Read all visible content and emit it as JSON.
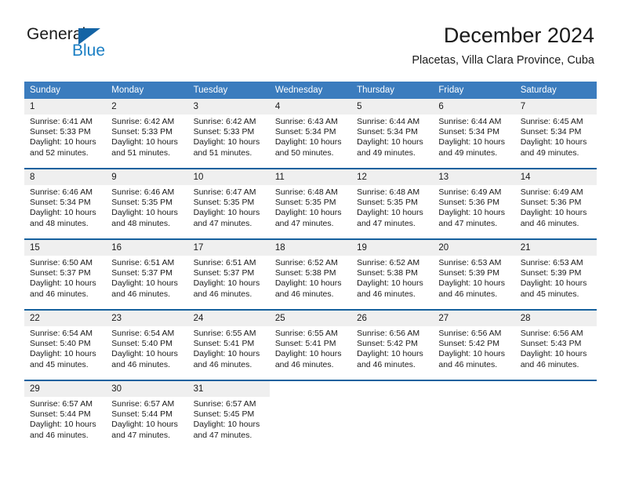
{
  "brand": {
    "name_top": "General",
    "name_bottom": "Blue",
    "triangle_color": "#1464a5",
    "blue_text_color": "#1b7fc4"
  },
  "header": {
    "title": "December 2024",
    "subtitle": "Placetas, Villa Clara Province, Cuba"
  },
  "colors": {
    "header_row_bg": "#3b7cbe",
    "row_separator": "#16619e",
    "daynum_band": "#efefef",
    "text": "#1a1a1a",
    "page_bg": "#ffffff"
  },
  "weekday_headers": [
    "Sunday",
    "Monday",
    "Tuesday",
    "Wednesday",
    "Thursday",
    "Friday",
    "Saturday"
  ],
  "weeks": [
    [
      {
        "day": "1",
        "sunrise": "Sunrise: 6:41 AM",
        "sunset": "Sunset: 5:33 PM",
        "daylight1": "Daylight: 10 hours",
        "daylight2": "and 52 minutes."
      },
      {
        "day": "2",
        "sunrise": "Sunrise: 6:42 AM",
        "sunset": "Sunset: 5:33 PM",
        "daylight1": "Daylight: 10 hours",
        "daylight2": "and 51 minutes."
      },
      {
        "day": "3",
        "sunrise": "Sunrise: 6:42 AM",
        "sunset": "Sunset: 5:33 PM",
        "daylight1": "Daylight: 10 hours",
        "daylight2": "and 51 minutes."
      },
      {
        "day": "4",
        "sunrise": "Sunrise: 6:43 AM",
        "sunset": "Sunset: 5:34 PM",
        "daylight1": "Daylight: 10 hours",
        "daylight2": "and 50 minutes."
      },
      {
        "day": "5",
        "sunrise": "Sunrise: 6:44 AM",
        "sunset": "Sunset: 5:34 PM",
        "daylight1": "Daylight: 10 hours",
        "daylight2": "and 49 minutes."
      },
      {
        "day": "6",
        "sunrise": "Sunrise: 6:44 AM",
        "sunset": "Sunset: 5:34 PM",
        "daylight1": "Daylight: 10 hours",
        "daylight2": "and 49 minutes."
      },
      {
        "day": "7",
        "sunrise": "Sunrise: 6:45 AM",
        "sunset": "Sunset: 5:34 PM",
        "daylight1": "Daylight: 10 hours",
        "daylight2": "and 49 minutes."
      }
    ],
    [
      {
        "day": "8",
        "sunrise": "Sunrise: 6:46 AM",
        "sunset": "Sunset: 5:34 PM",
        "daylight1": "Daylight: 10 hours",
        "daylight2": "and 48 minutes."
      },
      {
        "day": "9",
        "sunrise": "Sunrise: 6:46 AM",
        "sunset": "Sunset: 5:35 PM",
        "daylight1": "Daylight: 10 hours",
        "daylight2": "and 48 minutes."
      },
      {
        "day": "10",
        "sunrise": "Sunrise: 6:47 AM",
        "sunset": "Sunset: 5:35 PM",
        "daylight1": "Daylight: 10 hours",
        "daylight2": "and 47 minutes."
      },
      {
        "day": "11",
        "sunrise": "Sunrise: 6:48 AM",
        "sunset": "Sunset: 5:35 PM",
        "daylight1": "Daylight: 10 hours",
        "daylight2": "and 47 minutes."
      },
      {
        "day": "12",
        "sunrise": "Sunrise: 6:48 AM",
        "sunset": "Sunset: 5:35 PM",
        "daylight1": "Daylight: 10 hours",
        "daylight2": "and 47 minutes."
      },
      {
        "day": "13",
        "sunrise": "Sunrise: 6:49 AM",
        "sunset": "Sunset: 5:36 PM",
        "daylight1": "Daylight: 10 hours",
        "daylight2": "and 47 minutes."
      },
      {
        "day": "14",
        "sunrise": "Sunrise: 6:49 AM",
        "sunset": "Sunset: 5:36 PM",
        "daylight1": "Daylight: 10 hours",
        "daylight2": "and 46 minutes."
      }
    ],
    [
      {
        "day": "15",
        "sunrise": "Sunrise: 6:50 AM",
        "sunset": "Sunset: 5:37 PM",
        "daylight1": "Daylight: 10 hours",
        "daylight2": "and 46 minutes."
      },
      {
        "day": "16",
        "sunrise": "Sunrise: 6:51 AM",
        "sunset": "Sunset: 5:37 PM",
        "daylight1": "Daylight: 10 hours",
        "daylight2": "and 46 minutes."
      },
      {
        "day": "17",
        "sunrise": "Sunrise: 6:51 AM",
        "sunset": "Sunset: 5:37 PM",
        "daylight1": "Daylight: 10 hours",
        "daylight2": "and 46 minutes."
      },
      {
        "day": "18",
        "sunrise": "Sunrise: 6:52 AM",
        "sunset": "Sunset: 5:38 PM",
        "daylight1": "Daylight: 10 hours",
        "daylight2": "and 46 minutes."
      },
      {
        "day": "19",
        "sunrise": "Sunrise: 6:52 AM",
        "sunset": "Sunset: 5:38 PM",
        "daylight1": "Daylight: 10 hours",
        "daylight2": "and 46 minutes."
      },
      {
        "day": "20",
        "sunrise": "Sunrise: 6:53 AM",
        "sunset": "Sunset: 5:39 PM",
        "daylight1": "Daylight: 10 hours",
        "daylight2": "and 46 minutes."
      },
      {
        "day": "21",
        "sunrise": "Sunrise: 6:53 AM",
        "sunset": "Sunset: 5:39 PM",
        "daylight1": "Daylight: 10 hours",
        "daylight2": "and 45 minutes."
      }
    ],
    [
      {
        "day": "22",
        "sunrise": "Sunrise: 6:54 AM",
        "sunset": "Sunset: 5:40 PM",
        "daylight1": "Daylight: 10 hours",
        "daylight2": "and 45 minutes."
      },
      {
        "day": "23",
        "sunrise": "Sunrise: 6:54 AM",
        "sunset": "Sunset: 5:40 PM",
        "daylight1": "Daylight: 10 hours",
        "daylight2": "and 46 minutes."
      },
      {
        "day": "24",
        "sunrise": "Sunrise: 6:55 AM",
        "sunset": "Sunset: 5:41 PM",
        "daylight1": "Daylight: 10 hours",
        "daylight2": "and 46 minutes."
      },
      {
        "day": "25",
        "sunrise": "Sunrise: 6:55 AM",
        "sunset": "Sunset: 5:41 PM",
        "daylight1": "Daylight: 10 hours",
        "daylight2": "and 46 minutes."
      },
      {
        "day": "26",
        "sunrise": "Sunrise: 6:56 AM",
        "sunset": "Sunset: 5:42 PM",
        "daylight1": "Daylight: 10 hours",
        "daylight2": "and 46 minutes."
      },
      {
        "day": "27",
        "sunrise": "Sunrise: 6:56 AM",
        "sunset": "Sunset: 5:42 PM",
        "daylight1": "Daylight: 10 hours",
        "daylight2": "and 46 minutes."
      },
      {
        "day": "28",
        "sunrise": "Sunrise: 6:56 AM",
        "sunset": "Sunset: 5:43 PM",
        "daylight1": "Daylight: 10 hours",
        "daylight2": "and 46 minutes."
      }
    ],
    [
      {
        "day": "29",
        "sunrise": "Sunrise: 6:57 AM",
        "sunset": "Sunset: 5:44 PM",
        "daylight1": "Daylight: 10 hours",
        "daylight2": "and 46 minutes."
      },
      {
        "day": "30",
        "sunrise": "Sunrise: 6:57 AM",
        "sunset": "Sunset: 5:44 PM",
        "daylight1": "Daylight: 10 hours",
        "daylight2": "and 47 minutes."
      },
      {
        "day": "31",
        "sunrise": "Sunrise: 6:57 AM",
        "sunset": "Sunset: 5:45 PM",
        "daylight1": "Daylight: 10 hours",
        "daylight2": "and 47 minutes."
      },
      {
        "day": "",
        "sunrise": "",
        "sunset": "",
        "daylight1": "",
        "daylight2": ""
      },
      {
        "day": "",
        "sunrise": "",
        "sunset": "",
        "daylight1": "",
        "daylight2": ""
      },
      {
        "day": "",
        "sunrise": "",
        "sunset": "",
        "daylight1": "",
        "daylight2": ""
      },
      {
        "day": "",
        "sunrise": "",
        "sunset": "",
        "daylight1": "",
        "daylight2": ""
      }
    ]
  ]
}
